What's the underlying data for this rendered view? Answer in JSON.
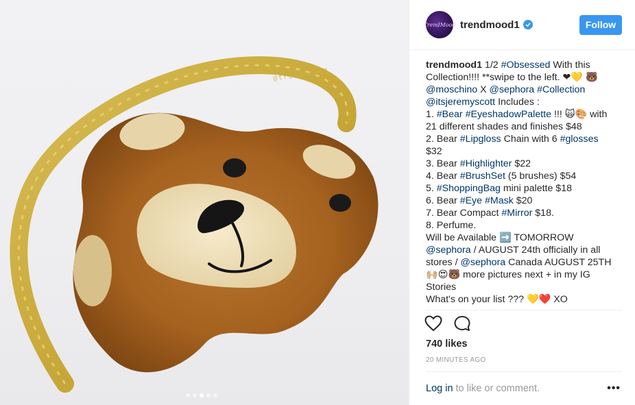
{
  "post": {
    "watermark": "@trendmood1",
    "carousel_dots": 5,
    "carousel_active_index": 2
  },
  "header": {
    "avatar_text": "TrendMood",
    "username": "trendmood1",
    "follow_label": "Follow"
  },
  "caption": {
    "lines": [
      [
        {
          "t": "trendmood1",
          "s": "b"
        },
        {
          "t": " 1/2 "
        },
        {
          "t": "#Obsessed",
          "s": "tag"
        },
        {
          "t": " With this"
        }
      ],
      [
        {
          "t": "Collection!!!! **swipe to the left. ❤💛 🐻"
        }
      ],
      [
        {
          "t": "@moschino",
          "s": "tag"
        },
        {
          "t": " X "
        },
        {
          "t": "@sephora",
          "s": "tag"
        },
        {
          "t": " "
        },
        {
          "t": "#Collection",
          "s": "tag"
        }
      ],
      [
        {
          "t": "@itsjeremyscott",
          "s": "tag"
        },
        {
          "t": " Includes :"
        }
      ],
      [
        {
          "t": "1. "
        },
        {
          "t": "#Bear",
          "s": "tag"
        },
        {
          "t": " "
        },
        {
          "t": "#EyeshadowPalette",
          "s": "tag"
        },
        {
          "t": " !!! 🙀🎨 with"
        }
      ],
      [
        {
          "t": "21 different shades and finishes $48"
        }
      ],
      [
        {
          "t": "2. Bear "
        },
        {
          "t": "#Lipgloss",
          "s": "tag"
        },
        {
          "t": " Chain with 6 "
        },
        {
          "t": "#glosses",
          "s": "tag"
        }
      ],
      [
        {
          "t": "$32"
        }
      ],
      [
        {
          "t": "3. Bear "
        },
        {
          "t": "#Highlighter",
          "s": "tag"
        },
        {
          "t": " $22"
        }
      ],
      [
        {
          "t": "4. Bear "
        },
        {
          "t": "#BrushSet",
          "s": "tag"
        },
        {
          "t": " (5 brushes) $54"
        }
      ],
      [
        {
          "t": "5. "
        },
        {
          "t": "#ShoppingBag",
          "s": "tag"
        },
        {
          "t": " mini palette $18"
        }
      ],
      [
        {
          "t": "6. Bear "
        },
        {
          "t": "#Eye",
          "s": "tag"
        },
        {
          "t": " "
        },
        {
          "t": "#Mask",
          "s": "tag"
        },
        {
          "t": " $20"
        }
      ],
      [
        {
          "t": "7. Bear Compact "
        },
        {
          "t": "#Mirror",
          "s": "tag"
        },
        {
          "t": " $18."
        }
      ],
      [
        {
          "t": "8. Perfume."
        }
      ],
      [
        {
          "t": "Will be Available ➡️ TOMORROW"
        }
      ],
      [
        {
          "t": "@sephora",
          "s": "tag"
        },
        {
          "t": " / AUGUST 24th officially in all"
        }
      ],
      [
        {
          "t": "stores / "
        },
        {
          "t": "@sephora",
          "s": "tag"
        },
        {
          "t": " Canada AUGUST 25TH"
        }
      ],
      [
        {
          "t": "🙌🏼😍🐻 more pictures next + in my IG"
        }
      ],
      [
        {
          "t": "Stories"
        }
      ],
      [
        {
          "t": "What's on your list ??? 💛❤️ XO"
        }
      ],
      [
        {
          "t": "..."
        }
      ]
    ]
  },
  "actions": {
    "like_icon": "heart-icon",
    "comment_icon": "comment-icon"
  },
  "likes": "740 likes",
  "timestamp": "20 MINUTES AGO",
  "footer": {
    "login_label": "Log in",
    "rest_text": "to like or comment.",
    "more_label": "•••"
  },
  "colors": {
    "accent": "#3897f0",
    "link": "#003569",
    "muted": "#999999",
    "text": "#262626"
  }
}
